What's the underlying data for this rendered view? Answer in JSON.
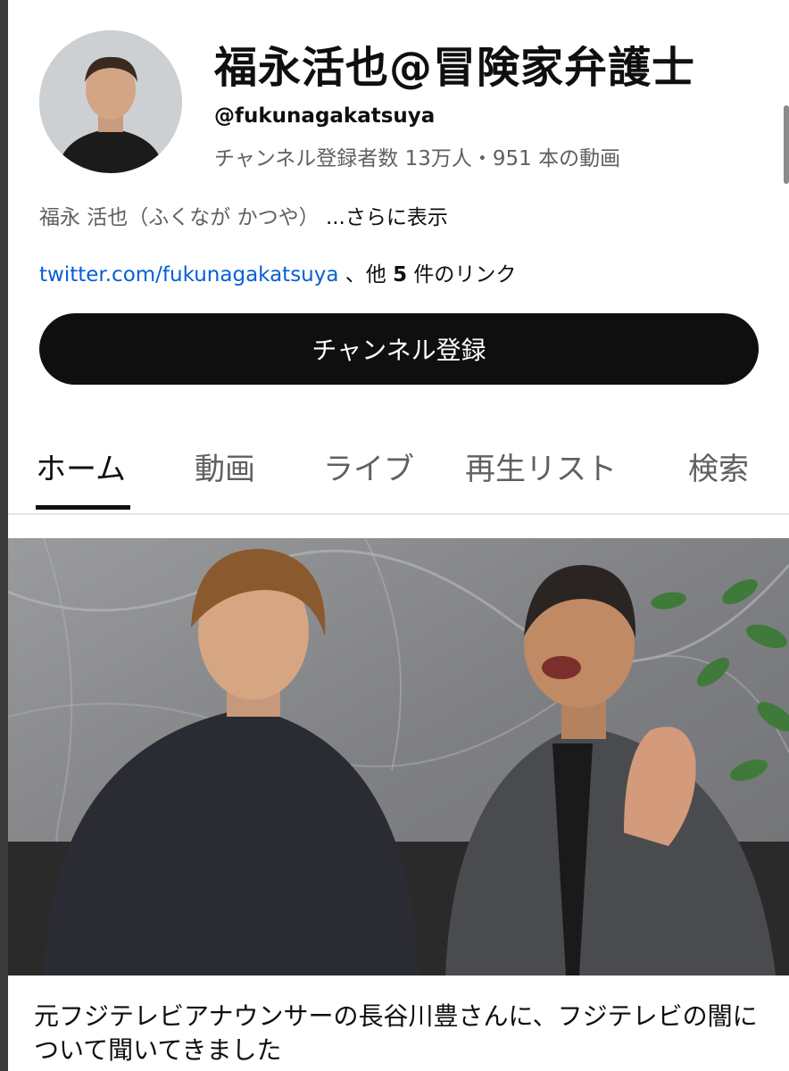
{
  "channel": {
    "name": "福永活也@冒険家弁護士",
    "handle": "@fukunagakatsuya",
    "stats": "チャンネル登録者数 13万人・951 本の動画",
    "description": "福永 活也（ふくなが かつや）",
    "description_more": "...さらに表示",
    "link_url": "twitter.com/fukunagakatsuya",
    "link_suffix_pre": "、他",
    "link_count": "5",
    "link_suffix_post": "件のリンク"
  },
  "subscribe_label": "チャンネル登録",
  "tabs": [
    {
      "label": "ホーム",
      "active": true
    },
    {
      "label": "動画"
    },
    {
      "label": "ライブ"
    },
    {
      "label": "再生リスト"
    },
    {
      "label": "検索"
    }
  ],
  "featured_video": {
    "title": "元フジテレビアナウンサーの長谷川豊さんに、フジテレビの闇について聞いてきました"
  },
  "colors": {
    "link": "#065fd4",
    "button_bg": "#0f0f0f",
    "secondary_text": "#606060"
  }
}
